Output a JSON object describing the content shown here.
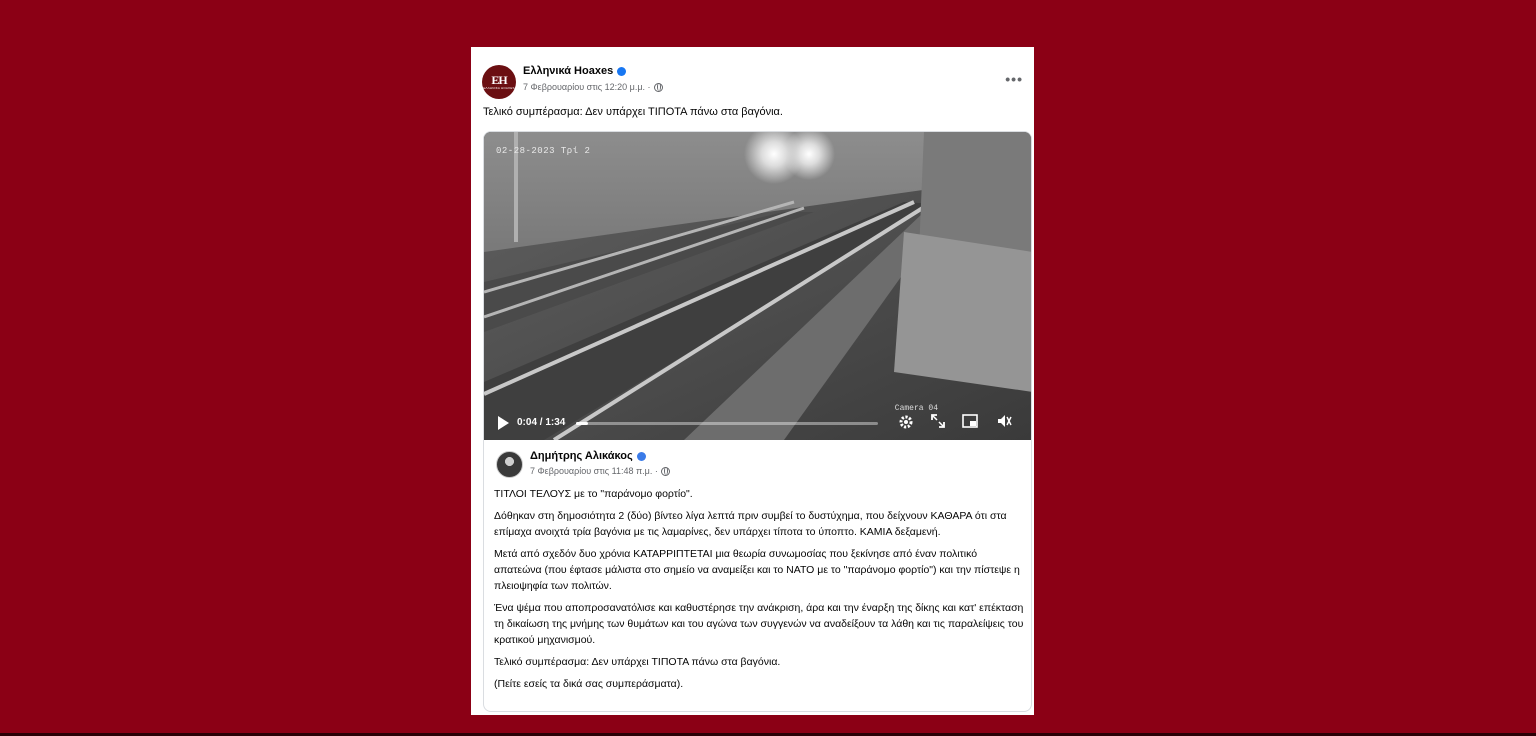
{
  "post": {
    "page_name": "Ελληνικά Hoaxes",
    "avatar_text": "EH",
    "avatar_small": "ΕΛΛΗΝΙΚΑ HOAXES",
    "timestamp": "7 Φεβρουαρίου στις 12:20 μ.μ. ·",
    "more_icon": "•••",
    "text": "Τελικό συμπέρασμα: Δεν υπάρχει ΤΙΠΟΤΑ πάνω στα βαγόνια."
  },
  "video": {
    "osd_text": "02-28-2023 Τρί 2",
    "camera_label": "Camera 04",
    "time": "0:04 / 1:34",
    "progress": 0.04,
    "icons": [
      "play-icon",
      "settings-icon",
      "fullscreen-icon",
      "pip-icon",
      "volume-icon"
    ]
  },
  "shared": {
    "author": "Δημήτρης Αλικάκος",
    "timestamp": "7 Φεβρουαρίου στις 11:48 π.μ. ·",
    "paragraphs": [
      "ΤΙΤΛΟΙ ΤΕΛΟΥΣ με το \"παράνομο φορτίο\".",
      "Δόθηκαν στη δημοσιότητα 2 (δύο) βίντεο λίγα λεπτά πριν συμβεί το δυστύχημα, που δείχνουν ΚΑΘΑΡΑ ότι στα επίμαχα ανοιχτά τρία βαγόνια με τις λαμαρίνες, δεν υπάρχει τίποτα το ύποπτο. ΚΑΜΙΑ δεξαμενή.",
      "Μετά από σχεδόν δυο χρόνια ΚΑΤΑΡΡΙΠΤΕΤΑΙ μια θεωρία συνωμοσίας που ξεκίνησε από έναν πολιτικό απατεώνα (που έφτασε μάλιστα στο σημείο να αναμείξει και το ΝΑΤΟ με το \"παράνομο φορτίο\") και την πίστεψε η πλειοψηφία των πολιτών.",
      "Ένα ψέμα που αποπροσανατόλισε και καθυστέρησε την ανάκριση, άρα και την έναρξη της δίκης και κατ' επέκταση τη δικαίωση της μνήμης των θυμάτων και του αγώνα των συγγενών να αναδείξουν τα λάθη και τις παραλείψεις του κρατικού μηχανισμού.",
      "Τελικό συμπέρασμα: Δεν υπάρχει ΤΙΠΟΤΑ πάνω στα βαγόνια.",
      "(Πείτε εσείς τα δικά σας συμπεράσματα)."
    ]
  },
  "colors": {
    "background": "#8b0015",
    "verified": "#1877f2"
  }
}
